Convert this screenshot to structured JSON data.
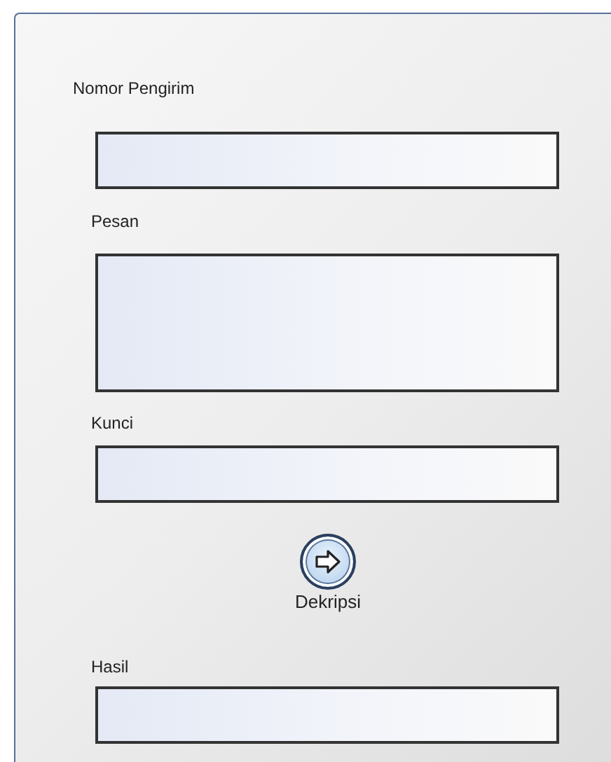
{
  "form": [
    {
      "kind": "field",
      "label": "Nomor Pengirim"
    },
    {
      "kind": "area",
      "label": "Pesan"
    },
    {
      "kind": "field",
      "label": "Kunci"
    },
    {
      "kind": "button",
      "label": "Dekripsi"
    },
    {
      "kind": "field",
      "label": "Hasil"
    }
  ]
}
